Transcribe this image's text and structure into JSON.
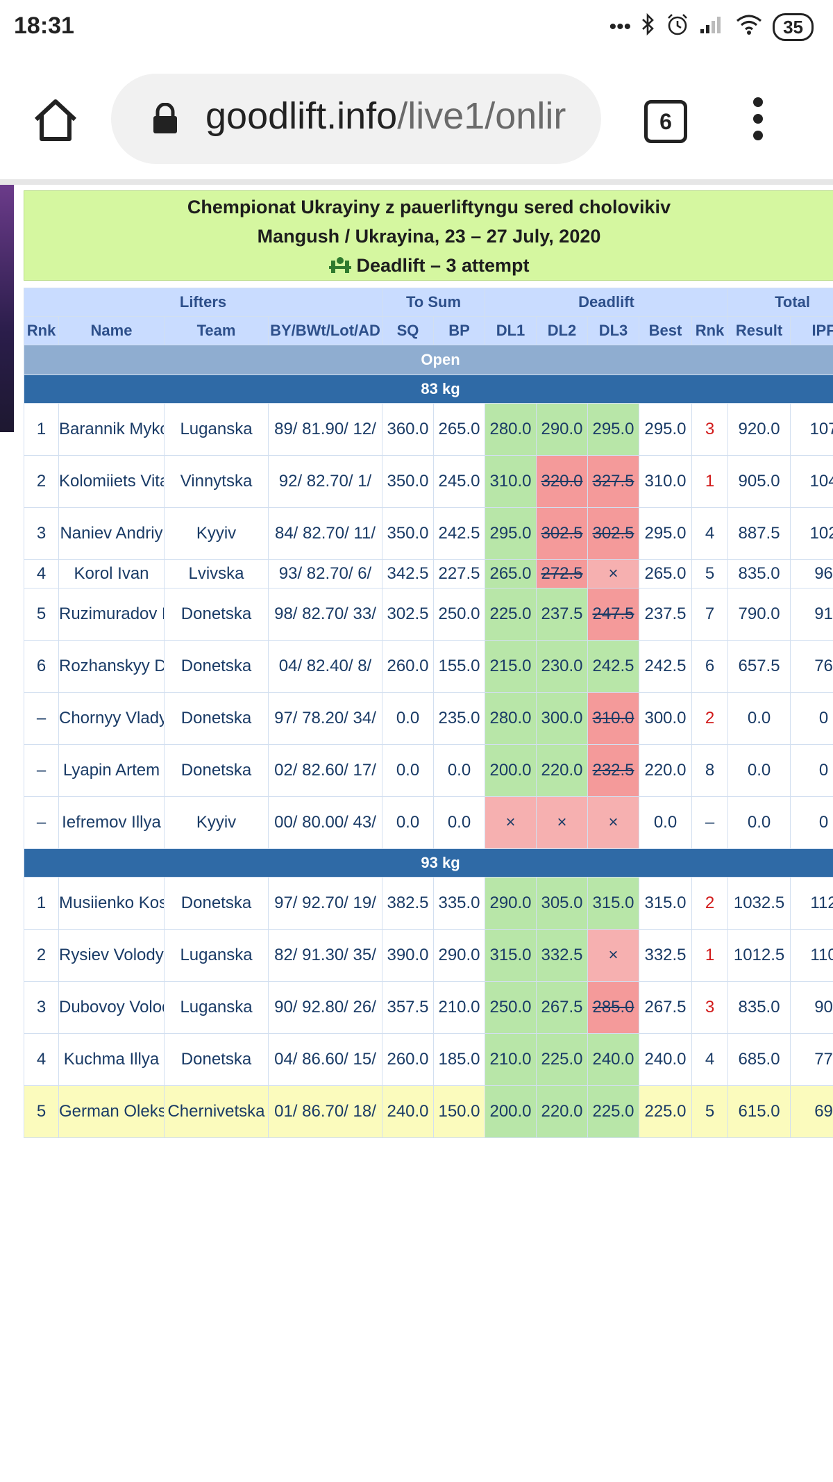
{
  "status_bar": {
    "time": "18:31",
    "battery": "35"
  },
  "browser": {
    "url_host": "goodlift.info",
    "url_path": "/live1/onlir",
    "tab_count": "6"
  },
  "banner": {
    "line1": "Chempionat Ukrayiny z pauerliftyngu sered cholovikiv",
    "line2": "Mangush / Ukrayina, 23 – 27 July, 2020",
    "line3": "Deadlift – 3 attempt"
  },
  "table": {
    "groups": {
      "lifters": "Lifters",
      "to_sum": "To Sum",
      "deadlift": "Deadlift",
      "total": "Total"
    },
    "columns": [
      "Rnk",
      "Name",
      "Team",
      "BY/BWt/Lot/AD",
      "SQ",
      "BP",
      "DL1",
      "DL2",
      "DL3",
      "Best",
      "Rnk",
      "Result",
      "IPF"
    ],
    "division": "Open",
    "categories": [
      {
        "label": "83 kg",
        "rows": [
          {
            "rnk": "1",
            "name": "Barannik Mykola",
            "team": "Luganska",
            "by": "89/ 81.90/ 12/",
            "sq": "360.0",
            "bp": "265.0",
            "dl1": "280.0",
            "dl2": "290.0",
            "dl3": "295.0",
            "best": "295.0",
            "drnk": "3",
            "result": "920.0",
            "ipf": "107",
            "s1": "good",
            "s2": "good",
            "s3": "good",
            "red": true
          },
          {
            "rnk": "2",
            "name": "Kolomiiets Vitaliy",
            "team": "Vinnytska",
            "by": "92/ 82.70/ 1/",
            "sq": "350.0",
            "bp": "245.0",
            "dl1": "310.0",
            "dl2": "320.0",
            "dl3": "327.5",
            "best": "310.0",
            "drnk": "1",
            "result": "905.0",
            "ipf": "104",
            "s1": "good",
            "s2": "bad",
            "s3": "bad",
            "red": true
          },
          {
            "rnk": "3",
            "name": "Naniev Andriy",
            "team": "Kyyiv",
            "by": "84/ 82.70/ 11/",
            "sq": "350.0",
            "bp": "242.5",
            "dl1": "295.0",
            "dl2": "302.5",
            "dl3": "302.5",
            "best": "295.0",
            "drnk": "4",
            "result": "887.5",
            "ipf": "102",
            "s1": "good",
            "s2": "bad",
            "s3": "bad",
            "red": false
          },
          {
            "rnk": "4",
            "name": "Korol Ivan",
            "team": "Lvivska",
            "by": "93/ 82.70/ 6/",
            "sq": "342.5",
            "bp": "227.5",
            "dl1": "265.0",
            "dl2": "272.5",
            "dl3": "×",
            "best": "265.0",
            "drnk": "5",
            "result": "835.0",
            "ipf": "96",
            "s1": "good",
            "s2": "bad",
            "s3": "fail",
            "red": false,
            "short": true
          },
          {
            "rnk": "5",
            "name": "Ruzimuradov Ruslan",
            "team": "Donetska",
            "by": "98/ 82.70/ 33/",
            "sq": "302.5",
            "bp": "250.0",
            "dl1": "225.0",
            "dl2": "237.5",
            "dl3": "247.5",
            "best": "237.5",
            "drnk": "7",
            "result": "790.0",
            "ipf": "91",
            "s1": "good",
            "s2": "good",
            "s3": "bad",
            "red": false
          },
          {
            "rnk": "6",
            "name": "Rozhanskyy Dmytro",
            "team": "Donetska",
            "by": "04/ 82.40/ 8/",
            "sq": "260.0",
            "bp": "155.0",
            "dl1": "215.0",
            "dl2": "230.0",
            "dl3": "242.5",
            "best": "242.5",
            "drnk": "6",
            "result": "657.5",
            "ipf": "76",
            "s1": "good",
            "s2": "good",
            "s3": "good",
            "red": false
          },
          {
            "rnk": "–",
            "name": "Chornyy Vladyslav",
            "team": "Donetska",
            "by": "97/ 78.20/ 34/",
            "sq": "0.0",
            "bp": "235.0",
            "dl1": "280.0",
            "dl2": "300.0",
            "dl3": "310.0",
            "best": "300.0",
            "drnk": "2",
            "result": "0.0",
            "ipf": "0",
            "s1": "good",
            "s2": "good",
            "s3": "bad",
            "red": true
          },
          {
            "rnk": "–",
            "name": "Lyapin Artem",
            "team": "Donetska",
            "by": "02/ 82.60/ 17/",
            "sq": "0.0",
            "bp": "0.0",
            "dl1": "200.0",
            "dl2": "220.0",
            "dl3": "232.5",
            "best": "220.0",
            "drnk": "8",
            "result": "0.0",
            "ipf": "0",
            "s1": "good",
            "s2": "good",
            "s3": "bad",
            "red": false
          },
          {
            "rnk": "–",
            "name": "Iefremov Illya",
            "team": "Kyyiv",
            "by": "00/ 80.00/ 43/",
            "sq": "0.0",
            "bp": "0.0",
            "dl1": "×",
            "dl2": "×",
            "dl3": "×",
            "best": "0.0",
            "drnk": "–",
            "result": "0.0",
            "ipf": "0",
            "s1": "fail",
            "s2": "fail",
            "s3": "fail",
            "red": false
          }
        ]
      },
      {
        "label": "93 kg",
        "rows": [
          {
            "rnk": "1",
            "name": "Musiienko Kostyantyn",
            "team": "Donetska",
            "by": "97/ 92.70/ 19/",
            "sq": "382.5",
            "bp": "335.0",
            "dl1": "290.0",
            "dl2": "305.0",
            "dl3": "315.0",
            "best": "315.0",
            "drnk": "2",
            "result": "1032.5",
            "ipf": "112",
            "s1": "good",
            "s2": "good",
            "s3": "good",
            "red": true
          },
          {
            "rnk": "2",
            "name": "Rysiev Volodymyr",
            "team": "Luganska",
            "by": "82/ 91.30/ 35/",
            "sq": "390.0",
            "bp": "290.0",
            "dl1": "315.0",
            "dl2": "332.5",
            "dl3": "×",
            "best": "332.5",
            "drnk": "1",
            "result": "1012.5",
            "ipf": "110",
            "s1": "good",
            "s2": "good",
            "s3": "fail",
            "red": true
          },
          {
            "rnk": "3",
            "name": "Dubovoy Volodymyr",
            "team": "Luganska",
            "by": "90/ 92.80/ 26/",
            "sq": "357.5",
            "bp": "210.0",
            "dl1": "250.0",
            "dl2": "267.5",
            "dl3": "285.0",
            "best": "267.5",
            "drnk": "3",
            "result": "835.0",
            "ipf": "90",
            "s1": "good",
            "s2": "good",
            "s3": "bad",
            "red": true
          },
          {
            "rnk": "4",
            "name": "Kuchma Illya",
            "team": "Donetska",
            "by": "04/ 86.60/ 15/",
            "sq": "260.0",
            "bp": "185.0",
            "dl1": "210.0",
            "dl2": "225.0",
            "dl3": "240.0",
            "best": "240.0",
            "drnk": "4",
            "result": "685.0",
            "ipf": "77",
            "s1": "good",
            "s2": "good",
            "s3": "good",
            "red": false
          },
          {
            "rnk": "5",
            "name": "German Oleksandr",
            "team": "Chernivetska",
            "by": "01/ 86.70/ 18/",
            "sq": "240.0",
            "bp": "150.0",
            "dl1": "200.0",
            "dl2": "220.0",
            "dl3": "225.0",
            "best": "225.0",
            "drnk": "5",
            "result": "615.0",
            "ipf": "69",
            "s1": "good",
            "s2": "good",
            "s3": "good",
            "red": false,
            "hl": true
          }
        ]
      }
    ]
  }
}
